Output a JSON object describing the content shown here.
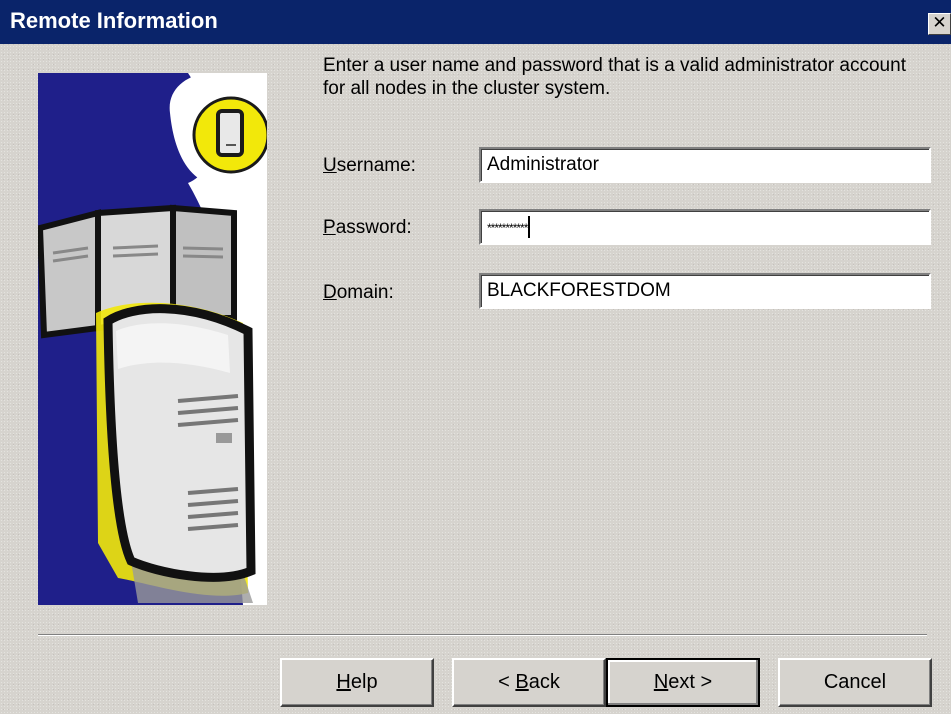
{
  "window": {
    "title": "Remote Information",
    "close_glyph": "✕",
    "title_color": "#0a246a"
  },
  "instructions": "Enter a user name and password that is a valid administrator account for all nodes in the cluster system.",
  "fields": {
    "username": {
      "label_accel": "U",
      "label_rest": "sername:",
      "value": "Administrator"
    },
    "password": {
      "label_accel": "P",
      "label_rest": "assword:",
      "value": "***********"
    },
    "domain": {
      "label_accel": "D",
      "label_rest": "omain:",
      "value": "BLACKFORESTDOM"
    }
  },
  "buttons": {
    "help": {
      "accel": "H",
      "rest": "elp"
    },
    "back": {
      "prefix": "< ",
      "accel": "B",
      "rest": "ack"
    },
    "next": {
      "accel": "N",
      "rest": "ext >"
    },
    "cancel": {
      "label": "Cancel"
    }
  },
  "illustration": {
    "icon": "server-cluster-illustration",
    "colors": {
      "navy": "#1f1f8a",
      "yellow": "#f2e80a",
      "gray": "#b8b8b8"
    }
  }
}
